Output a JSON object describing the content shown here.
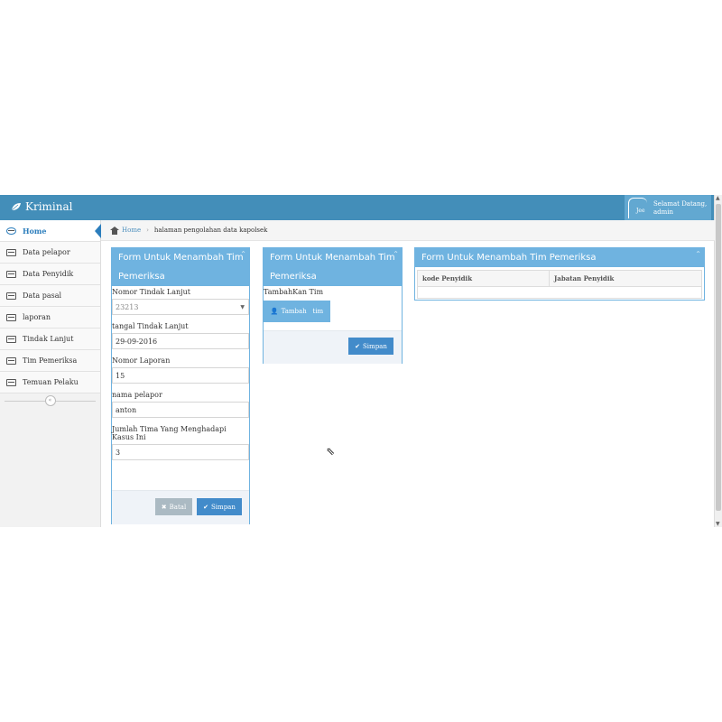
{
  "app": {
    "brand": "Kriminal"
  },
  "user": {
    "greeting": "Selamat Datang,",
    "name": "admin",
    "avatar_text": "Jee"
  },
  "sidebar": {
    "items": [
      {
        "label": "Home",
        "icon": "dashboard-icon",
        "active": true
      },
      {
        "label": "Data pelapor",
        "icon": "list-icon"
      },
      {
        "label": "Data Penyidik",
        "icon": "list-icon"
      },
      {
        "label": "Data pasal",
        "icon": "list-icon"
      },
      {
        "label": "laporan",
        "icon": "list-icon"
      },
      {
        "label": "Tindak Lanjut",
        "icon": "list-icon"
      },
      {
        "label": "Tim Pemeriksa",
        "icon": "list-icon"
      },
      {
        "label": "Temuan Pelaku",
        "icon": "list-icon"
      }
    ],
    "collapse_glyph": "«"
  },
  "breadcrumb": {
    "home": "Home",
    "separator": "›",
    "current": "halaman pengolahan data kapolsek"
  },
  "form1": {
    "title": "Form Untuk Menambah Tim Pemeriksa",
    "fields": [
      {
        "label": "Nomor Tindak Lanjut",
        "value": "23213",
        "type": "select"
      },
      {
        "label": "tangal Tindak Lanjut",
        "value": "29-09-2016"
      },
      {
        "label": "Nomor Laporan",
        "value": "15"
      },
      {
        "label": "nama pelapor",
        "value": "anton"
      },
      {
        "label": "Jumlah Tima Yang Menghadapi Kasus Ini",
        "value": "3"
      }
    ],
    "cancel": "Batal",
    "save": "Simpan"
  },
  "form2": {
    "title": "Form Untuk Menambah Tim Pemeriksa",
    "label": "TambahKan Tim",
    "add_button": "Tambah   tim",
    "save": "Simpan"
  },
  "panel3": {
    "title": "Form Untuk Menambah Tim Pemeriksa",
    "columns": [
      "kode Penyidik",
      "Jabatan Penyidik"
    ]
  },
  "colors": {
    "navbar": "#438eb9",
    "box_header": "#6fb3e0",
    "primary_button": "#428bca"
  }
}
